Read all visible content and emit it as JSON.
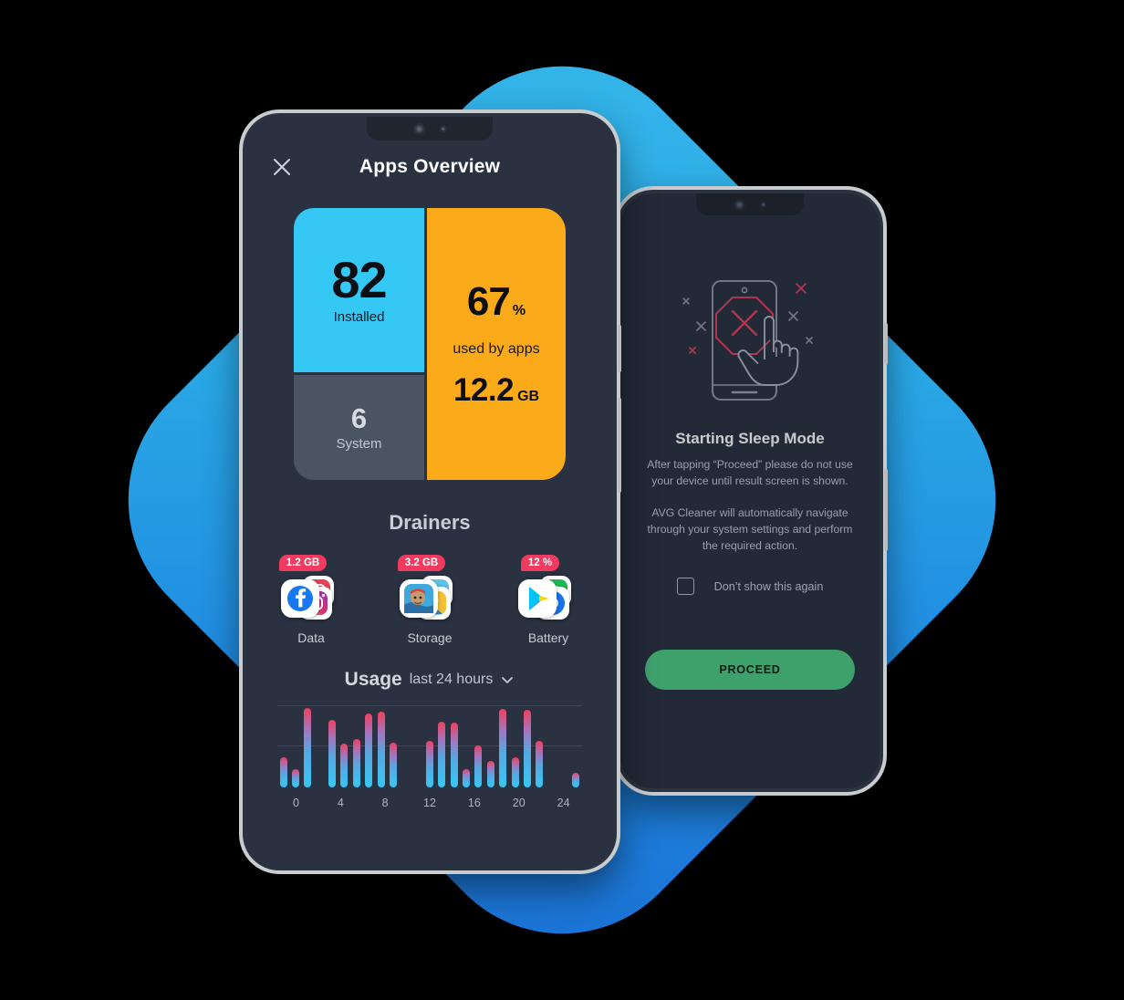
{
  "background": {
    "shape": "rounded-diamond",
    "color_from": "#35b7ea",
    "color_to": "#1a6fd4"
  },
  "phone_front": {
    "appbar": {
      "title": "Apps Overview",
      "close_icon": "close-icon"
    },
    "cards": {
      "installed": {
        "value": "82",
        "label": "Installed",
        "color": "#35c8f5"
      },
      "system": {
        "value": "6",
        "label": "System",
        "color": "#4b5463"
      },
      "used": {
        "percent": "67",
        "percent_unit": "%",
        "middle_label": "used by apps",
        "size": "12.2",
        "size_unit": "GB",
        "color": "#fbaa19"
      }
    },
    "drainers_title": "Drainers",
    "drainers": [
      {
        "badge": "1.2 GB",
        "caption": "Data",
        "front_icon": "facebook-icon",
        "back_icons": [
          "instagram-icon",
          "instagram-alt-icon"
        ]
      },
      {
        "badge": "3.2 GB",
        "caption": "Storage",
        "front_icon": "game-boom-beach-icon",
        "back_icons": [
          "game-clash-icon",
          "game-yellow-icon"
        ]
      },
      {
        "badge": "12 %",
        "caption": "Battery",
        "front_icon": "google-play-icon",
        "back_icons": [
          "spotify-icon",
          "chrome-icon"
        ]
      }
    ],
    "usage": {
      "title": "Usage",
      "subtitle": "last 24 hours",
      "chevron_icon": "chevron-down-icon"
    },
    "badge_color": "#f03a5f"
  },
  "phone_back": {
    "title": "Starting Sleep Mode",
    "paragraph1": "After tapping “Proceed” please do not use your device until result screen is shown.",
    "paragraph2": "AVG Cleaner will automatically navigate through your system settings and perform the required action.",
    "checkbox_label": "Don’t show this again",
    "checkbox_checked": false,
    "button_label": "PROCEED",
    "button_color": "#4ecb85",
    "illustration": "phone-blocked-tap-icon"
  },
  "chart_data": {
    "type": "bar",
    "title": "Usage",
    "subtitle": "last 24 hours",
    "xlabel": "",
    "ylabel": "",
    "grid": true,
    "gridlines": [
      0.52,
      0.98
    ],
    "xticks": [
      "0",
      "4",
      "8",
      "12",
      "16",
      "20",
      "24"
    ],
    "x": [
      0,
      1,
      2,
      3,
      4,
      5,
      6,
      7,
      8,
      9,
      10,
      11,
      12,
      13,
      14,
      15,
      16,
      17,
      18,
      19,
      20,
      21,
      22,
      23,
      24
    ],
    "values": [
      0.36,
      0.22,
      0.95,
      0.0,
      0.8,
      0.52,
      0.58,
      0.88,
      0.9,
      0.53,
      0.0,
      0.0,
      0.55,
      0.78,
      0.77,
      0.22,
      0.5,
      0.32,
      0.93,
      0.36,
      0.92,
      0.55,
      0.0,
      0.0,
      0.17
    ],
    "ylim": [
      0,
      1
    ],
    "bar_gradient_low": "#35c8f5",
    "bar_gradient_high": "#f0405f"
  }
}
